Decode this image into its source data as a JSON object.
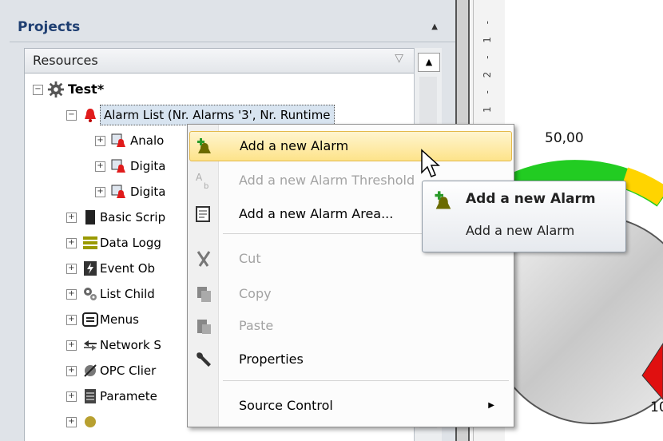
{
  "panel": {
    "title": "Projects",
    "resources_label": "Resources"
  },
  "tree": {
    "root": "Test*",
    "items": [
      {
        "label": "Alarm List (Nr. Alarms '3', Nr. Runtime",
        "icon": "bell-icon"
      },
      {
        "label": "Analo",
        "icon": "alarm-item-icon"
      },
      {
        "label": "Digita",
        "icon": "alarm-item-icon"
      },
      {
        "label": "Digita",
        "icon": "alarm-item-icon"
      },
      {
        "label": "Basic Scrip",
        "icon": "script-icon"
      },
      {
        "label": "Data Logg",
        "icon": "database-icon"
      },
      {
        "label": "Event Ob",
        "icon": "event-icon"
      },
      {
        "label": "List Child",
        "icon": "gears-icon"
      },
      {
        "label": "Menus",
        "icon": "menu-icon"
      },
      {
        "label": "Network S",
        "icon": "network-icon"
      },
      {
        "label": "OPC Clier",
        "icon": "opc-icon"
      },
      {
        "label": "Paramete",
        "icon": "parameter-icon"
      }
    ]
  },
  "context_menu": {
    "items": [
      {
        "label": "Add a new Alarm",
        "icon": "add-alarm-icon",
        "enabled": true,
        "highlight": true
      },
      {
        "label": "Add a new Alarm Threshold",
        "icon": "threshold-icon",
        "enabled": false
      },
      {
        "label": "Add a new Alarm Area...",
        "icon": "alarm-area-icon",
        "enabled": true
      },
      {
        "label": "Cut",
        "icon": "cut-icon",
        "enabled": false
      },
      {
        "label": "Copy",
        "icon": "copy-icon",
        "enabled": false
      },
      {
        "label": "Paste",
        "icon": "paste-icon",
        "enabled": false
      },
      {
        "label": "Properties",
        "icon": "wrench-icon",
        "enabled": true
      },
      {
        "label": "Source Control",
        "icon": "",
        "enabled": true,
        "submenu": true
      }
    ]
  },
  "tooltip": {
    "title": "Add a new Alarm",
    "description": "Add a new Alarm"
  },
  "gauge": {
    "value": "50,00",
    "tick": "10"
  },
  "ruler": {
    "marks": "1 - 1 - 2 - 1 -"
  },
  "colors": {
    "highlight": "#fde38a",
    "panel_title": "#1f3f72",
    "gauge_green": "#22cc22",
    "gauge_red": "#e01010"
  }
}
